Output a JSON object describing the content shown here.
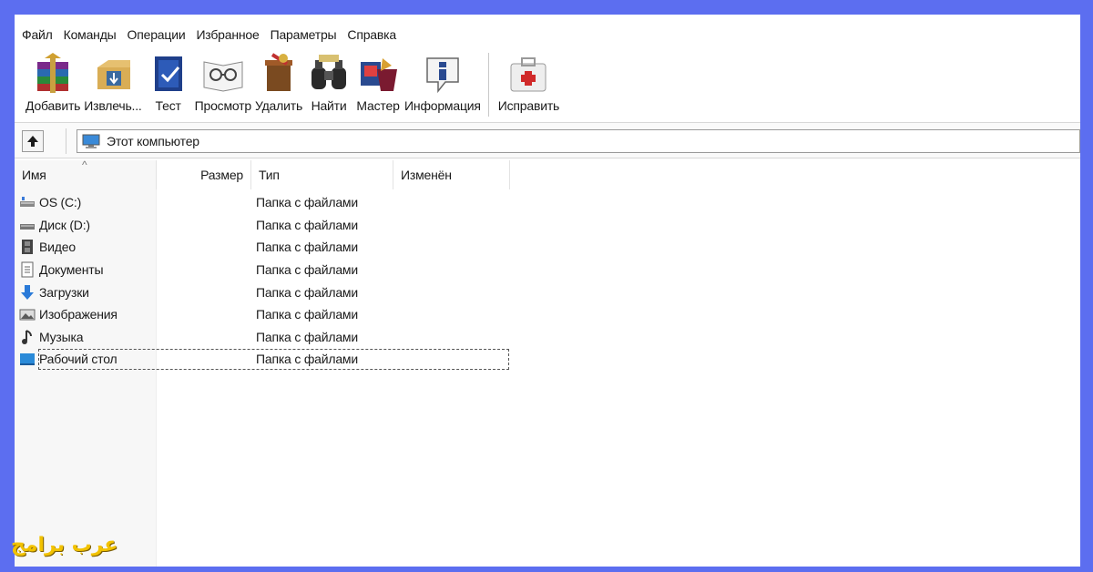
{
  "menu": [
    "Файл",
    "Команды",
    "Операции",
    "Избранное",
    "Параметры",
    "Справка"
  ],
  "toolbar": [
    {
      "label": "Добавить",
      "icon": "add-archive-icon"
    },
    {
      "label": "Извлечь...",
      "icon": "extract-icon"
    },
    {
      "label": "Тест",
      "icon": "test-icon"
    },
    {
      "label": "Просмотр",
      "icon": "view-icon"
    },
    {
      "label": "Удалить",
      "icon": "delete-icon"
    },
    {
      "label": "Найти",
      "icon": "find-icon"
    },
    {
      "label": "Мастер",
      "icon": "wizard-icon"
    },
    {
      "label": "Информация",
      "icon": "info-icon"
    },
    {
      "label": "Исправить",
      "icon": "repair-icon"
    }
  ],
  "address": {
    "path": "Этот компьютер"
  },
  "columns": [
    "Имя",
    "Размер",
    "Тип",
    "Изменён"
  ],
  "files": [
    {
      "name": "OS (C:)",
      "type": "Папка с файлами",
      "icon": "drive-icon"
    },
    {
      "name": "Диск (D:)",
      "type": "Папка с файлами",
      "icon": "drive-icon"
    },
    {
      "name": "Видео",
      "type": "Папка с файлами",
      "icon": "video-icon"
    },
    {
      "name": "Документы",
      "type": "Папка с файлами",
      "icon": "documents-icon"
    },
    {
      "name": "Загрузки",
      "type": "Папка с файлами",
      "icon": "downloads-icon"
    },
    {
      "name": "Изображения",
      "type": "Папка с файлами",
      "icon": "pictures-icon"
    },
    {
      "name": "Музыка",
      "type": "Папка с файлами",
      "icon": "music-icon"
    },
    {
      "name": "Рабочий стол",
      "type": "Папка с файлами",
      "icon": "desktop-icon"
    }
  ],
  "selected_row": "Рабочий стол",
  "watermark": "عرب برامج",
  "colors": {
    "frame": "#5c6ef0",
    "watermark": "#f2c200"
  }
}
